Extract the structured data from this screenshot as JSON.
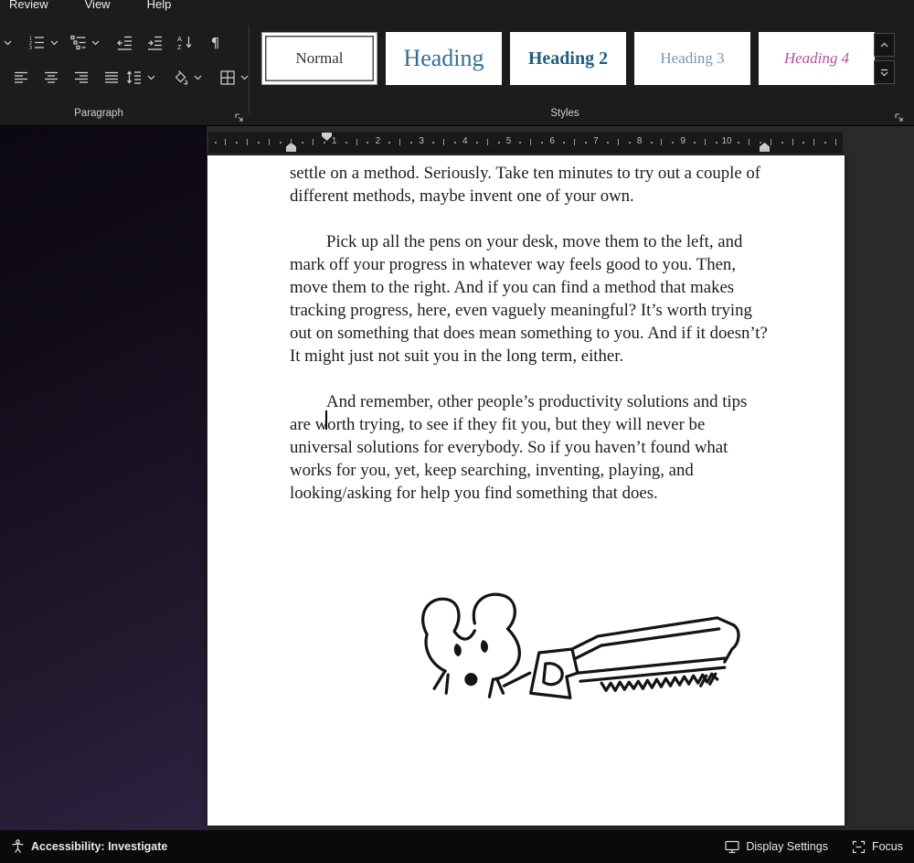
{
  "menu": {
    "items": [
      "Review",
      "View",
      "Help"
    ]
  },
  "ribbon": {
    "paragraph_group_label": "Paragraph",
    "styles_group_label": "Styles",
    "styles": [
      {
        "label": "Normal"
      },
      {
        "label": "Heading"
      },
      {
        "label": "Heading 2"
      },
      {
        "label": "Heading 3"
      },
      {
        "label": "Heading 4"
      }
    ]
  },
  "ruler": {
    "numbers": [
      "1",
      "2",
      "3",
      "4",
      "5",
      "6",
      "7",
      "8",
      "9",
      "10"
    ]
  },
  "document": {
    "paragraphs": [
      "settle on a method. Seriously. Take ten minutes to try out a couple of different methods, maybe invent one of your own.",
      "Pick up all the pens on your desk, move them to the left, and mark off your progress in whatever way feels good to you. Then, move them to the right. And if you can find a method that makes tracking progress, here, even vaguely meaningful? It’s worth trying out on something that does mean something to you. And if it doesn’t? It might just not suit you in the long term, either.",
      "And remember, other people’s productivity solutions and tips are worth trying, to see if they fit you, but they will never be universal solutions for everybody. So if you haven’t found what works for you, yet, keep searching, inventing, playing, and looking/asking for help you find something that does."
    ],
    "drawing": "hand-drawn sketch of a mouse head and a hacksaw"
  },
  "status_bar": {
    "accessibility_label": "Accessibility: Investigate",
    "display_settings_label": "Display Settings",
    "focus_label": "Focus"
  },
  "colors": {
    "heading1": "#2f7096",
    "heading2": "#1e5f7d",
    "heading3": "#7a98ab",
    "heading4": "#b0519e",
    "accent_desktop": "#2d2240"
  }
}
